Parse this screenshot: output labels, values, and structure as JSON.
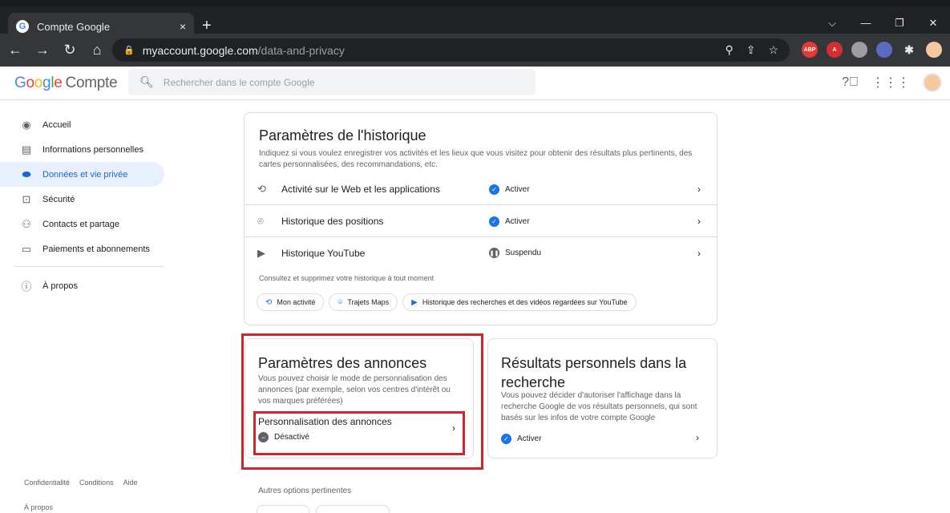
{
  "browser": {
    "tab_title": "Compte Google",
    "tab_close": "×",
    "new_tab": "+",
    "url_host": "myaccount.google.com",
    "url_path": "/data-and-privacy"
  },
  "header": {
    "logo_parts": [
      "G",
      "o",
      "o",
      "g",
      "l",
      "e"
    ],
    "product": "Compte",
    "search_placeholder": "Rechercher dans le compte Google"
  },
  "sidebar": {
    "items": [
      {
        "label": "Accueil",
        "icon": "account-circle-icon"
      },
      {
        "label": "Informations personnelles",
        "icon": "id-card-icon"
      },
      {
        "label": "Données et vie privée",
        "icon": "toggle-icon"
      },
      {
        "label": "Sécurité",
        "icon": "lock-icon"
      },
      {
        "label": "Contacts et partage",
        "icon": "people-icon"
      },
      {
        "label": "Paiements et abonnements",
        "icon": "card-icon"
      }
    ],
    "about": "À propos",
    "footer": [
      "Confidentialité",
      "Conditions",
      "Aide"
    ],
    "footer_about": "À propos"
  },
  "history": {
    "title": "Paramètres de l'historique",
    "desc": "Indiquez si vous voulez enregistrer vos activités et les lieux que vous visitez pour obtenir des résultats plus pertinents, des cartes personnalisées, des recommandations, etc.",
    "rows": [
      {
        "label": "Activité sur le Web et les applications",
        "status": "Activer"
      },
      {
        "label": "Historique des positions",
        "status": "Activer"
      },
      {
        "label": "Historique YouTube",
        "status": "Suspendu"
      }
    ],
    "consult": "Consultez et supprimez votre historique à tout moment",
    "chips": [
      "Mon activité",
      "Trajets Maps",
      "Historique des recherches et des vidéos regardées sur YouTube"
    ]
  },
  "ads": {
    "title": "Paramètres des annonces",
    "desc": "Vous pouvez choisir le mode de personnalisation des annonces (par exemple, selon vos centres d'intérêt ou vos marques préférées)",
    "setting_label": "Personnalisation des annonces",
    "setting_status": "Désactivé"
  },
  "personal": {
    "title": "Résultats personnels dans la recherche",
    "desc": "Vous pouvez décider d'autoriser l'affichage dans la recherche Google de vos résultats personnels, qui sont basés sur les infos de votre compte Google",
    "status": "Activer"
  },
  "other": {
    "label": "Autres options pertinentes"
  },
  "colors": {
    "accent": "#1a73e8",
    "highlight_border": "#d3242b",
    "active_nav_bg": "#e8f0fe"
  }
}
